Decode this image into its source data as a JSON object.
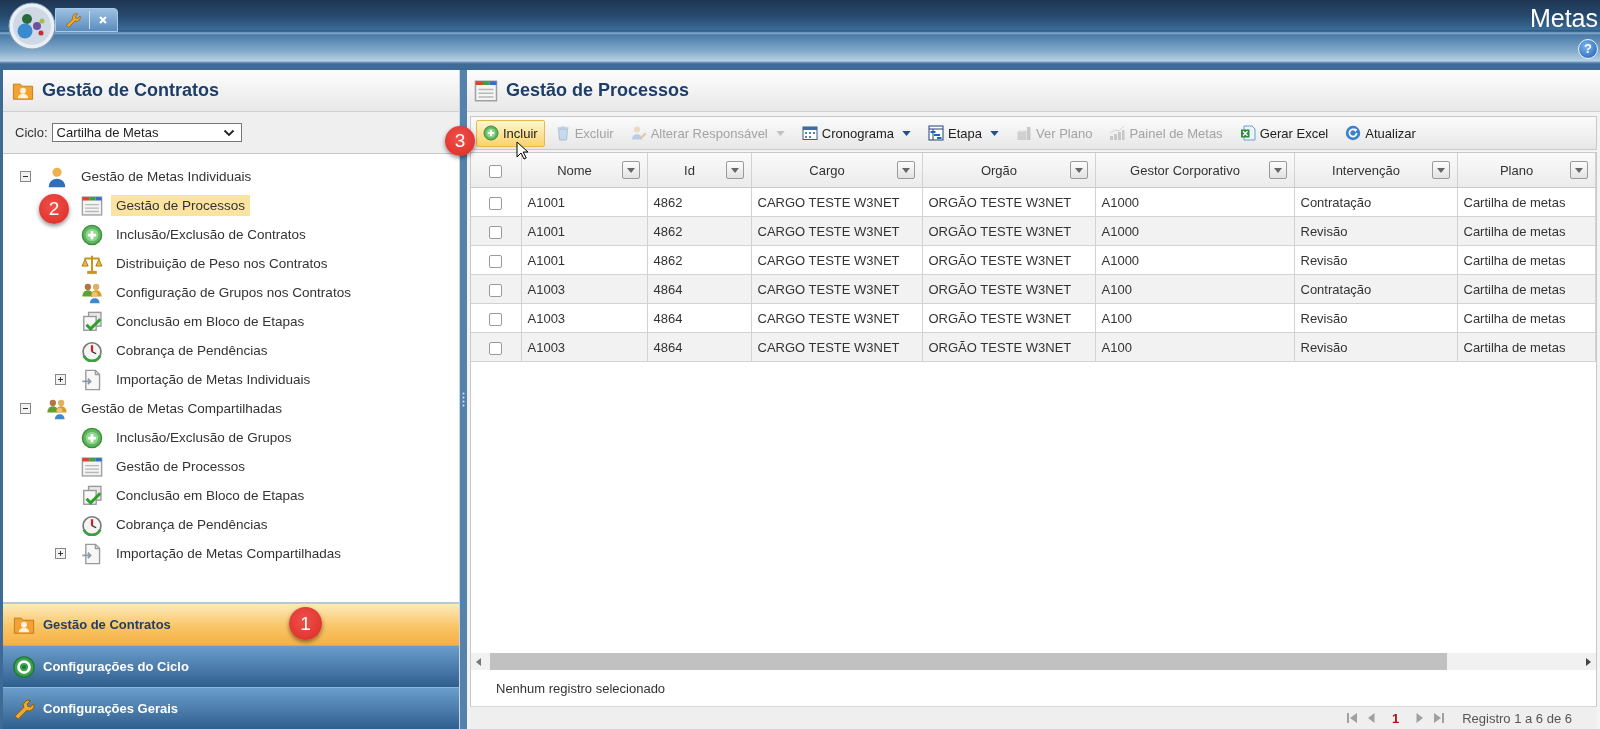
{
  "app_bar": {
    "title": "Metas",
    "help": "?"
  },
  "left_panel": {
    "title": "Gestão de Contratos",
    "cycle": {
      "label": "Ciclo:",
      "value": "Cartilha de Metas"
    },
    "tree": [
      {
        "label": "Gestão de Metas Individuais",
        "expanded": true,
        "selected": false,
        "children": [
          {
            "label": "Gestão de Processos",
            "selected": true,
            "callout": "2"
          },
          {
            "label": "Inclusão/Exclusão de Contratos",
            "selected": false
          },
          {
            "label": "Distribuição de Peso nos Contratos",
            "selected": false
          },
          {
            "label": "Configuração de Grupos nos Contratos",
            "selected": false
          },
          {
            "label": "Conclusão em Bloco de Etapas",
            "selected": false
          },
          {
            "label": "Cobrança de Pendências",
            "selected": false
          },
          {
            "label": "Importação de Metas Individuais",
            "selected": false,
            "expanded": false
          }
        ]
      },
      {
        "label": "Gestão de Metas Compartilhadas",
        "expanded": true,
        "selected": false,
        "children": [
          {
            "label": "Inclusão/Exclusão de Grupos",
            "selected": false
          },
          {
            "label": "Gestão de Processos",
            "selected": false
          },
          {
            "label": "Conclusão em Bloco de Etapas",
            "selected": false
          },
          {
            "label": "Cobrança de Pendências",
            "selected": false
          },
          {
            "label": "Importação de Metas Compartilhadas",
            "selected": false,
            "expanded": false
          }
        ]
      }
    ],
    "accordion": [
      {
        "label": "Gestão de Contratos",
        "selected": true,
        "callout": "1"
      },
      {
        "label": "Configurações do Ciclo",
        "selected": false
      },
      {
        "label": "Configurações Gerais",
        "selected": false
      }
    ]
  },
  "main_panel": {
    "title": "Gestão de Processos",
    "toolbar": [
      {
        "label": "Incluir",
        "disabled": false,
        "hovered": true,
        "menu": false,
        "callout": "3"
      },
      {
        "label": "Excluir",
        "disabled": true,
        "hovered": false,
        "menu": false
      },
      {
        "label": "Alterar Responsável",
        "disabled": true,
        "hovered": false,
        "menu": true
      },
      {
        "label": "Cronograma",
        "disabled": false,
        "hovered": false,
        "menu": true
      },
      {
        "label": "Etapa",
        "disabled": false,
        "hovered": false,
        "menu": true
      },
      {
        "label": "Ver Plano",
        "disabled": true,
        "hovered": false,
        "menu": false
      },
      {
        "label": "Painel de Metas",
        "disabled": true,
        "hovered": false,
        "menu": false
      },
      {
        "label": "Gerar Excel",
        "disabled": false,
        "hovered": false,
        "menu": false
      },
      {
        "label": "Atualizar",
        "disabled": false,
        "hovered": false,
        "menu": false
      }
    ],
    "table": {
      "select_all_checked": false,
      "columns": [
        "Nome",
        "Id",
        "Cargo",
        "Orgão",
        "Gestor Corporativo",
        "Intervenção",
        "Plano"
      ],
      "rows": [
        {
          "checked": false,
          "cells": [
            "A1001",
            "4862",
            "CARGO TESTE W3NET",
            "ORGÃO TESTE W3NET",
            "A1000",
            "Contratação",
            "Cartilha de metas"
          ]
        },
        {
          "checked": false,
          "cells": [
            "A1001",
            "4862",
            "CARGO TESTE W3NET",
            "ORGÃO TESTE W3NET",
            "A1000",
            "Revisão",
            "Cartilha de metas"
          ]
        },
        {
          "checked": false,
          "cells": [
            "A1001",
            "4862",
            "CARGO TESTE W3NET",
            "ORGÃO TESTE W3NET",
            "A1000",
            "Revisão",
            "Cartilha de metas"
          ]
        },
        {
          "checked": false,
          "cells": [
            "A1003",
            "4864",
            "CARGO TESTE W3NET",
            "ORGÃO TESTE W3NET",
            "A100",
            "Contratação",
            "Cartilha de metas"
          ]
        },
        {
          "checked": false,
          "cells": [
            "A1003",
            "4864",
            "CARGO TESTE W3NET",
            "ORGÃO TESTE W3NET",
            "A100",
            "Revisão",
            "Cartilha de metas"
          ]
        },
        {
          "checked": false,
          "cells": [
            "A1003",
            "4864",
            "CARGO TESTE W3NET",
            "ORGÃO TESTE W3NET",
            "A100",
            "Revisão",
            "Cartilha de metas"
          ]
        }
      ]
    },
    "status": "Nenhum registro selecionado",
    "pager": {
      "page": "1",
      "summary": "Registro 1 a 6 de 6"
    }
  }
}
